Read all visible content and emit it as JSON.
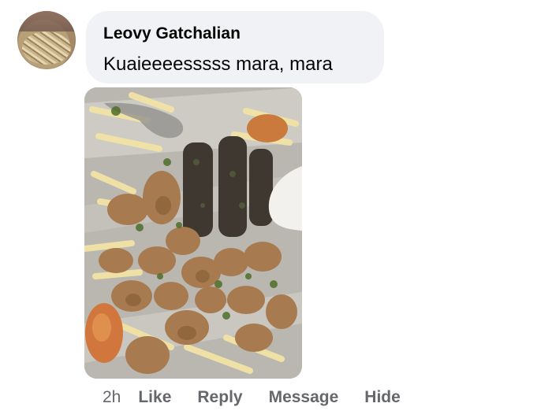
{
  "comment": {
    "author": "Leovy Gatchalian",
    "text": "Kuaieeeesssss mara, mara",
    "timestamp": "2h",
    "actions": [
      "Like",
      "Reply",
      "Message",
      "Hide"
    ],
    "avatar_icon": "profile-photo-noodles",
    "photo_icon": "food-platter-photo"
  },
  "colors": {
    "bubble_bg": "#f0f2f5",
    "text_primary": "#050505",
    "text_secondary": "#65676b"
  }
}
